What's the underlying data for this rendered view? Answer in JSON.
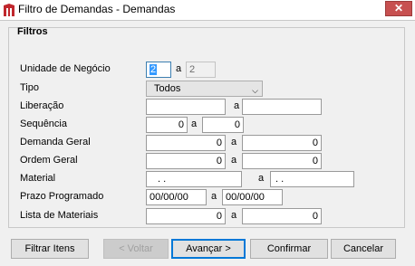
{
  "window": {
    "title": "Filtro de Demandas - Demandas",
    "close_label": "✕",
    "brand_color": "#c0272d"
  },
  "filters": {
    "title": "Filtros",
    "unidade": {
      "label": "Unidade de Negócio",
      "from": "2",
      "sep": "a",
      "to": "2"
    },
    "tipo": {
      "label": "Tipo",
      "value": "Todos"
    },
    "liberacao": {
      "label": "Liberação",
      "from": "",
      "sep": "a",
      "to": ""
    },
    "sequencia": {
      "label": "Sequência",
      "from": "0",
      "sep": "a",
      "to": "0"
    },
    "demanda_geral": {
      "label": "Demanda Geral",
      "from": "0",
      "sep": "a",
      "to": "0"
    },
    "ordem_geral": {
      "label": "Ordem Geral",
      "from": "0",
      "sep": "a",
      "to": "0"
    },
    "material": {
      "label": "Material",
      "from": ". .",
      "sep": "a",
      "to": ". ."
    },
    "prazo": {
      "label": "Prazo Programado",
      "from": "00/00/00",
      "sep": "a",
      "to": "00/00/00"
    },
    "lista": {
      "label": "Lista de Materiais",
      "from": "0",
      "sep": "a",
      "to": "0"
    }
  },
  "buttons": {
    "filtrar": "Filtrar Itens",
    "voltar": "< Voltar",
    "avancar": "Avançar >",
    "confirmar": "Confirmar",
    "cancelar": "Cancelar"
  }
}
